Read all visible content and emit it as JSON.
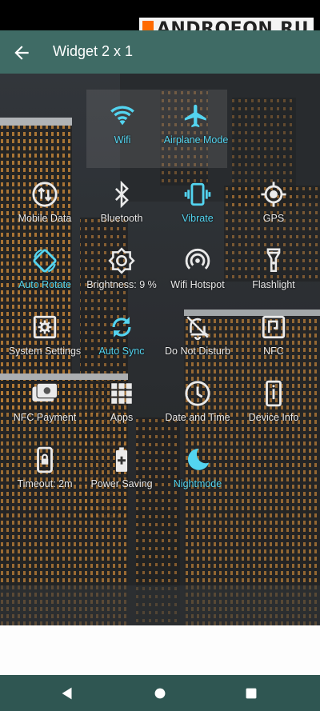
{
  "watermark": "ANDROFON.RU",
  "header": {
    "title": "Widget 2 x 1"
  },
  "tiles": [
    {
      "label": "Wifi",
      "icon": "wifi-icon",
      "active": true
    },
    {
      "label": "Airplane Mode",
      "icon": "airplane-icon",
      "active": true
    },
    {
      "label": "Mobile Data",
      "icon": "mobile-data-icon",
      "active": false
    },
    {
      "label": "Bluetooth",
      "icon": "bluetooth-icon",
      "active": false
    },
    {
      "label": "Vibrate",
      "icon": "vibrate-icon",
      "active": true
    },
    {
      "label": "GPS",
      "icon": "gps-icon",
      "active": false
    },
    {
      "label": "Auto Rotate",
      "icon": "auto-rotate-icon",
      "active": true
    },
    {
      "label": "Brightness: 9 %",
      "icon": "brightness-icon",
      "active": false
    },
    {
      "label": "Wifi Hotspot",
      "icon": "hotspot-icon",
      "active": false
    },
    {
      "label": "Flashlight",
      "icon": "flashlight-icon",
      "active": false
    },
    {
      "label": "System Settings",
      "icon": "settings-icon",
      "active": false
    },
    {
      "label": "Auto Sync",
      "icon": "sync-icon",
      "active": true
    },
    {
      "label": "Do Not Disturb",
      "icon": "dnd-icon",
      "active": false
    },
    {
      "label": "NFC",
      "icon": "nfc-icon",
      "active": false
    },
    {
      "label": "NFC Payment",
      "icon": "payment-icon",
      "active": false
    },
    {
      "label": "Apps",
      "icon": "apps-icon",
      "active": false
    },
    {
      "label": "Date and Time",
      "icon": "clock-icon",
      "active": false
    },
    {
      "label": "Device Info",
      "icon": "info-icon",
      "active": false
    },
    {
      "label": "Timeout: 2m",
      "icon": "timeout-icon",
      "active": false
    },
    {
      "label": "Power Saving",
      "icon": "battery-icon",
      "active": false
    },
    {
      "label": "Nightmode",
      "icon": "moon-icon",
      "active": true
    }
  ],
  "colors": {
    "active": "#53d4f0",
    "inactive": "#eaeaea",
    "appbar": "#3f6b65",
    "navbar": "#2f5652"
  }
}
